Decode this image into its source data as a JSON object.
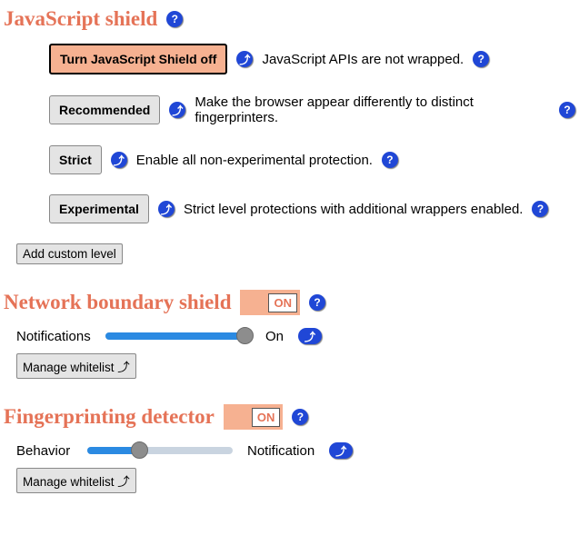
{
  "js_shield": {
    "title": "JavaScript shield",
    "levels": [
      {
        "label": "Turn JavaScript Shield off",
        "desc": "JavaScript APIs are not wrapped.",
        "selected": true
      },
      {
        "label": "Recommended",
        "desc": "Make the browser appear differently to distinct fingerprinters.",
        "selected": false
      },
      {
        "label": "Strict",
        "desc": "Enable all non-experimental protection.",
        "selected": false
      },
      {
        "label": "Experimental",
        "desc": "Strict level protections with additional wrappers enabled.",
        "selected": false
      }
    ],
    "add_custom_label": "Add custom level"
  },
  "network_shield": {
    "title": "Network boundary shield",
    "toggle_label": "ON",
    "notifications_label": "Notifications",
    "notifications_value": "On",
    "notifications_fill_pct": 95,
    "manage_label": "Manage whitelist ⤴"
  },
  "fingerprint": {
    "title": "Fingerprinting detector",
    "toggle_label": "ON",
    "behavior_label": "Behavior",
    "behavior_value": "Notification",
    "behavior_fill_pct": 34,
    "manage_label": "Manage whitelist ⤴"
  }
}
